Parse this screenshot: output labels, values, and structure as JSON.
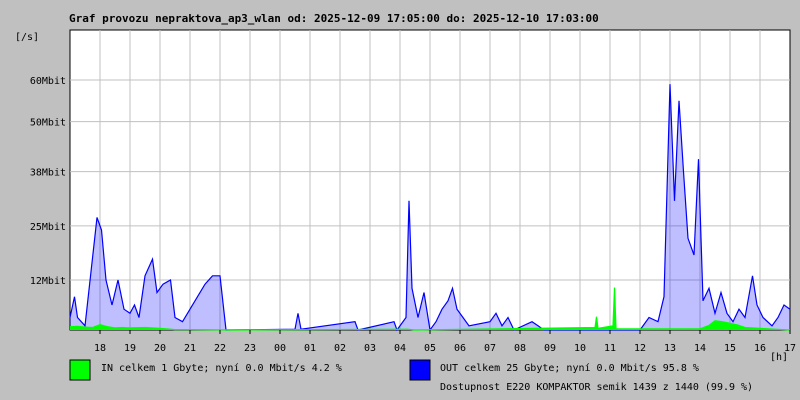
{
  "chart_data": {
    "type": "area",
    "title": "Graf provozu nepraktova_ap3_wlan od: 2025-12-09 17:05:00 do: 2025-12-10 17:03:00",
    "ylabel": "[/s]",
    "xlabel": "[h]",
    "x_unit": "hour",
    "x_ticks": [
      "18",
      "19",
      "20",
      "21",
      "22",
      "23",
      "00",
      "01",
      "02",
      "03",
      "04",
      "05",
      "06",
      "07",
      "08",
      "09",
      "10",
      "11",
      "12",
      "13",
      "14",
      "15",
      "16",
      "17"
    ],
    "y_ticks": [
      "12Mbit",
      "25Mbit",
      "38Mbit",
      "50Mbit",
      "60Mbit"
    ],
    "y_tick_values": [
      12,
      25,
      38,
      50,
      60
    ],
    "ylim": [
      0,
      72
    ],
    "y_unit": "Mbit/s",
    "grid": true,
    "series": [
      {
        "name": "IN",
        "color": "#00ff00",
        "legend_text": "IN celkem 1 Gbyte; nyní   0.0 Mbit/s 4.2 %",
        "points": [
          [
            0.0,
            0.8
          ],
          [
            0.25,
            0.9
          ],
          [
            0.5,
            0.7
          ],
          [
            0.75,
            0.6
          ],
          [
            1.0,
            1.3
          ],
          [
            1.25,
            0.8
          ],
          [
            1.5,
            0.5
          ],
          [
            1.75,
            0.6
          ],
          [
            2.0,
            0.5
          ],
          [
            2.5,
            0.6
          ],
          [
            3.0,
            0.4
          ],
          [
            3.5,
            0.1
          ],
          [
            4.0,
            0.1
          ],
          [
            5.5,
            0.0
          ],
          [
            11.25,
            0.2
          ],
          [
            11.5,
            0.0
          ],
          [
            17.5,
            0.6
          ],
          [
            17.55,
            3.2
          ],
          [
            17.6,
            0.4
          ],
          [
            18.1,
            1.0
          ],
          [
            18.15,
            10.2
          ],
          [
            18.2,
            0.3
          ],
          [
            21.0,
            0.3
          ],
          [
            21.3,
            1.1
          ],
          [
            21.5,
            2.2
          ],
          [
            21.75,
            2.0
          ],
          [
            22.0,
            1.6
          ],
          [
            22.25,
            1.2
          ],
          [
            22.5,
            0.6
          ],
          [
            23.0,
            0.4
          ],
          [
            23.5,
            0.2
          ],
          [
            24.0,
            0.0
          ]
        ]
      },
      {
        "name": "OUT",
        "color": "#0000ff",
        "legend_text": "OUT celkem 25 Gbyte; nyní   0.0 Mbit/s 95.8 %",
        "points": [
          [
            0.0,
            3.0
          ],
          [
            0.15,
            8.0
          ],
          [
            0.25,
            3.0
          ],
          [
            0.5,
            1.0
          ],
          [
            0.7,
            14.0
          ],
          [
            0.9,
            27.0
          ],
          [
            1.05,
            24.0
          ],
          [
            1.2,
            12.0
          ],
          [
            1.4,
            6.0
          ],
          [
            1.6,
            12.0
          ],
          [
            1.8,
            5.0
          ],
          [
            2.0,
            4.0
          ],
          [
            2.15,
            6.0
          ],
          [
            2.3,
            3.0
          ],
          [
            2.5,
            13.0
          ],
          [
            2.75,
            17.0
          ],
          [
            2.9,
            9.0
          ],
          [
            3.1,
            11.0
          ],
          [
            3.35,
            12.0
          ],
          [
            3.5,
            3.0
          ],
          [
            3.75,
            2.0
          ],
          [
            4.0,
            5.0
          ],
          [
            4.25,
            8.0
          ],
          [
            4.5,
            11.0
          ],
          [
            4.75,
            13.0
          ],
          [
            5.0,
            13.0
          ],
          [
            5.2,
            0.0
          ],
          [
            7.5,
            0.2
          ],
          [
            7.6,
            4.0
          ],
          [
            7.7,
            0.2
          ],
          [
            9.5,
            2.0
          ],
          [
            9.6,
            0.0
          ],
          [
            10.8,
            2.0
          ],
          [
            10.9,
            0.0
          ],
          [
            11.2,
            3.0
          ],
          [
            11.3,
            31.0
          ],
          [
            11.4,
            10.0
          ],
          [
            11.6,
            3.0
          ],
          [
            11.8,
            9.0
          ],
          [
            12.0,
            0.0
          ],
          [
            12.2,
            2.0
          ],
          [
            12.4,
            5.0
          ],
          [
            12.6,
            7.0
          ],
          [
            12.75,
            10.0
          ],
          [
            12.9,
            5.0
          ],
          [
            13.1,
            3.0
          ],
          [
            13.3,
            1.0
          ],
          [
            14.0,
            2.0
          ],
          [
            14.2,
            4.0
          ],
          [
            14.4,
            1.0
          ],
          [
            14.6,
            3.0
          ],
          [
            14.8,
            0.0
          ],
          [
            15.4,
            2.0
          ],
          [
            15.6,
            1.0
          ],
          [
            15.8,
            0.0
          ],
          [
            19.0,
            0.0
          ],
          [
            19.3,
            3.0
          ],
          [
            19.6,
            2.0
          ],
          [
            19.8,
            8.0
          ],
          [
            20.0,
            59.0
          ],
          [
            20.15,
            31.0
          ],
          [
            20.3,
            55.0
          ],
          [
            20.45,
            38.0
          ],
          [
            20.6,
            22.0
          ],
          [
            20.8,
            18.0
          ],
          [
            20.95,
            41.0
          ],
          [
            21.1,
            7.0
          ],
          [
            21.3,
            10.0
          ],
          [
            21.5,
            4.0
          ],
          [
            21.7,
            9.0
          ],
          [
            21.9,
            4.0
          ],
          [
            22.1,
            2.0
          ],
          [
            22.3,
            5.0
          ],
          [
            22.5,
            3.0
          ],
          [
            22.75,
            13.0
          ],
          [
            22.9,
            6.0
          ],
          [
            23.1,
            3.0
          ],
          [
            23.4,
            1.0
          ],
          [
            23.6,
            3.0
          ],
          [
            23.8,
            6.0
          ],
          [
            24.0,
            5.0
          ]
        ]
      }
    ],
    "availability_text": "Dostupnost E220 KOMPAKTOR semik 1439 z 1440 (99.9 %)",
    "availability_color": "#ff0000",
    "background_color": "#c0c0c0",
    "plot_color": "#ffffff",
    "grid_color": "#c0c0c0"
  }
}
